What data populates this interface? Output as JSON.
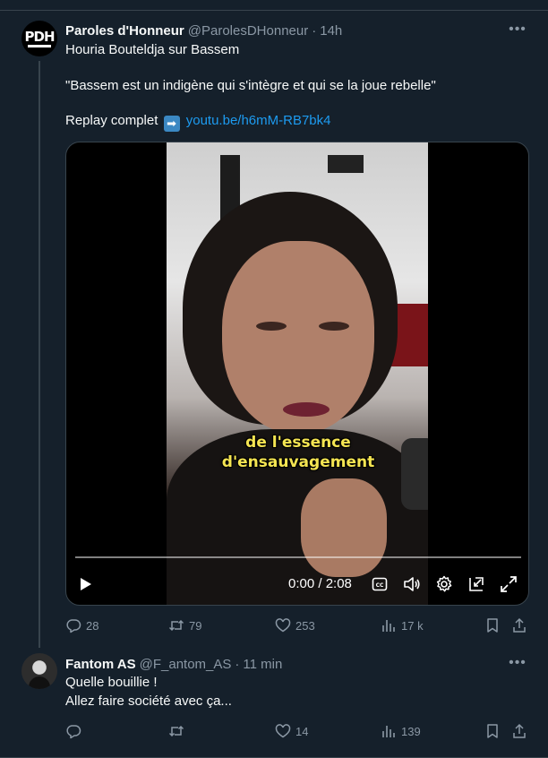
{
  "tweet": {
    "author_name": "Paroles d'Honneur",
    "author_handle": "@ParolesDHonneur",
    "separator": "·",
    "time": "14h",
    "avatar_text": "PDH",
    "line1": "Houria Bouteldja sur Bassem",
    "quote": "\"Bassem est un indigène qui s'intègre et qui se la joue rebelle\"",
    "replay_label": "Replay complet",
    "arrow_emoji": "➡",
    "link": "youtu.be/h6mM-RB7bk4",
    "video": {
      "subtitle_line1": "de l'essence",
      "subtitle_line2": "d'ensauvagement",
      "timecode": "0:00 / 2:08",
      "progress": 0.0
    },
    "stats": {
      "replies": "28",
      "retweets": "79",
      "likes": "253",
      "views": "17 k"
    }
  },
  "reply": {
    "author_name": "Fantom AS",
    "author_handle": "@F_antom_AS",
    "separator": "·",
    "time": "11 min",
    "line1": "Quelle bouillie !",
    "line2": "Allez faire société avec ça...",
    "stats": {
      "replies": "",
      "retweets": "",
      "likes": "14",
      "views": "139"
    }
  },
  "colors": {
    "background": "#15202b",
    "text": "#f7f9f9",
    "muted": "#8b98a5",
    "link": "#1d9bf0",
    "border": "#38444d",
    "subtitle": "#f5e552"
  },
  "icons": [
    "more-icon",
    "reply-icon",
    "retweet-icon",
    "like-icon",
    "views-icon",
    "bookmark-icon",
    "share-icon",
    "play-icon",
    "captions-icon",
    "volume-icon",
    "settings-icon",
    "pip-icon",
    "fullscreen-icon",
    "arrow-right-emoji"
  ]
}
